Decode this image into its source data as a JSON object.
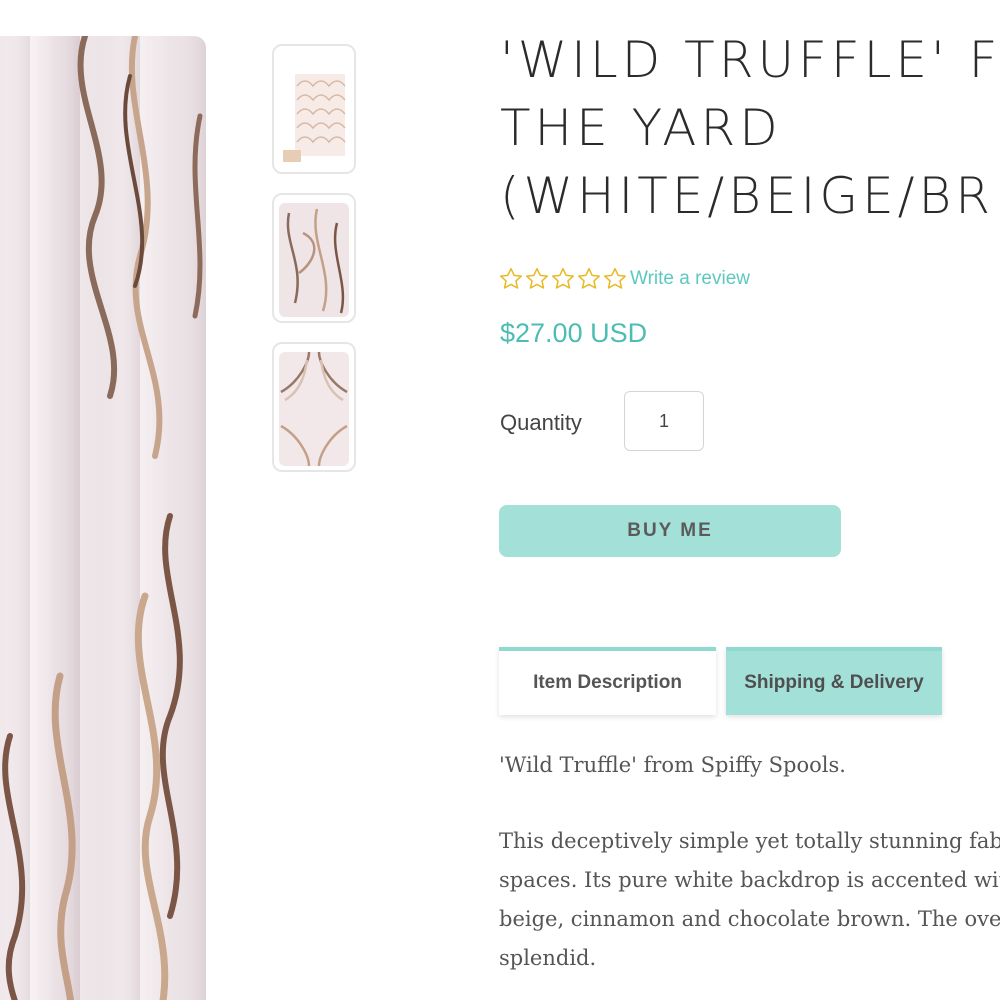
{
  "product": {
    "title_lines": [
      "'WILD TRUFFLE' F",
      "THE YARD",
      "(WHITE/BEIGE/BR"
    ],
    "rating_stars": 0,
    "rating_max": 5,
    "review_link": "Write a review",
    "price": "$27.00 USD"
  },
  "purchase": {
    "quantity_label": "Quantity",
    "quantity_value": "1",
    "buy_label": "BUY ME"
  },
  "tabs": [
    {
      "label": "Item Description",
      "active": true
    },
    {
      "label": "Shipping & Delivery",
      "active": false
    }
  ],
  "description": {
    "intro": "'Wild Truffle' from Spiffy Spools.",
    "body_lines": [
      "This deceptively simple yet totally stunning fabric",
      "spaces. Its pure white backdrop is accented with",
      "beige, cinnamon and chocolate brown. The over",
      "splendid."
    ]
  },
  "colors": {
    "accent": "#5cc8c0",
    "button_bg": "#a3e0d8",
    "star_outline": "#e8b923"
  },
  "gallery": {
    "thumbnails": [
      "fabric-roll-thumbnail",
      "fabric-drape-thumbnail",
      "fabric-pattern-closeup-thumbnail"
    ]
  }
}
